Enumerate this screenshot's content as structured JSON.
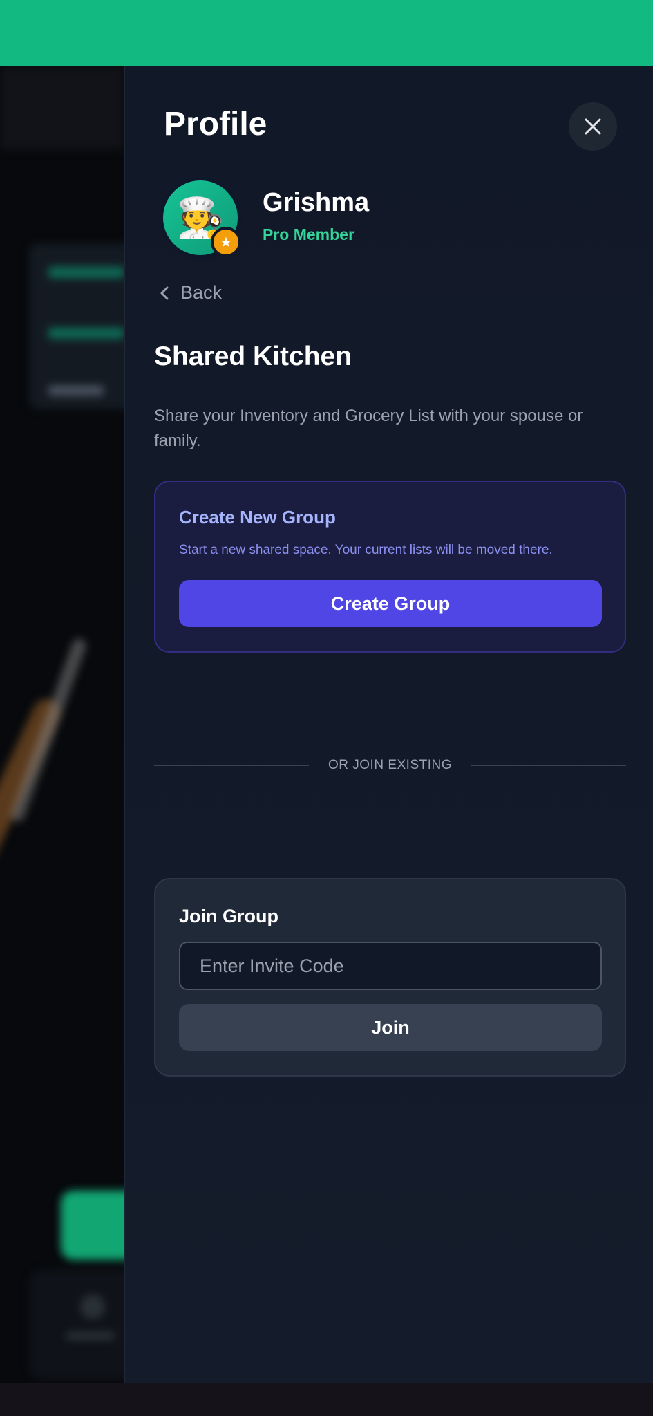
{
  "panel": {
    "title": "Profile",
    "close_icon": "close-icon"
  },
  "user": {
    "name": "Grishma",
    "role": "Pro Member",
    "avatar_emoji": "🧑‍🍳",
    "badge_icon": "star-icon"
  },
  "nav": {
    "back_label": "Back",
    "back_icon": "chevron-left-icon"
  },
  "shared_kitchen": {
    "title": "Shared Kitchen",
    "description": "Share your Inventory and Grocery List with your spouse or family."
  },
  "create_group": {
    "title": "Create New Group",
    "description": "Start a new shared space. Your current lists will be moved there.",
    "button_label": "Create Group"
  },
  "divider": {
    "label": "OR JOIN EXISTING"
  },
  "join_group": {
    "title": "Join Group",
    "input_placeholder": "Enter Invite Code",
    "input_value": "",
    "button_label": "Join"
  },
  "colors": {
    "status_bar": "#12b981",
    "accent_green": "#34d399",
    "primary_indigo": "#4f46e5",
    "badge_orange": "#f59e0b"
  }
}
